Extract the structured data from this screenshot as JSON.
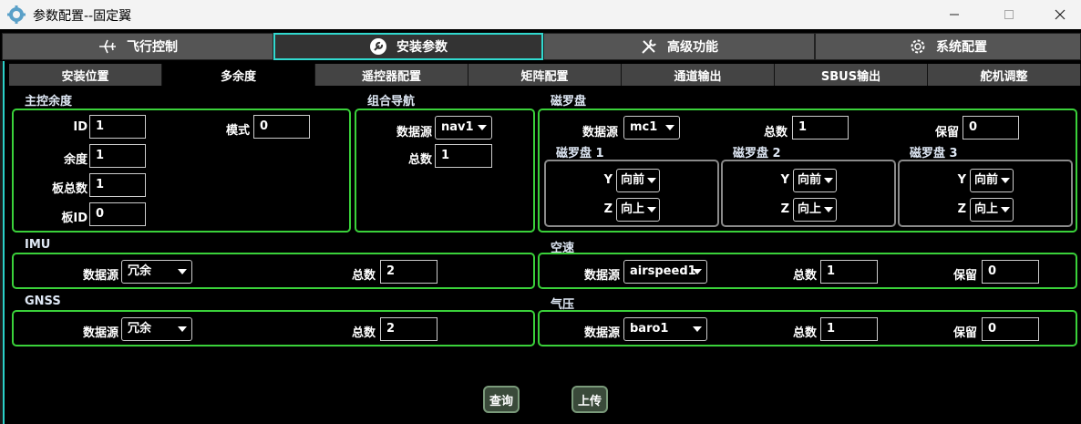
{
  "window": {
    "title": "参数配置--固定翼"
  },
  "top_tabs": [
    {
      "label": "飞行控制",
      "icon": "airplane-icon"
    },
    {
      "label": "安装参数",
      "icon": "wrench-icon"
    },
    {
      "label": "高级功能",
      "icon": "tools-icon"
    },
    {
      "label": "系统配置",
      "icon": "gear-icon"
    }
  ],
  "sub_tabs": [
    "安装位置",
    "多余度",
    "遥控器配置",
    "矩阵配置",
    "通道输出",
    "SBUS输出",
    "舵机调整"
  ],
  "main_control": {
    "title": "主控余度",
    "id_label": "ID",
    "id_value": "1",
    "mode_label": "模式",
    "mode_value": "0",
    "redundancy_label": "余度",
    "redundancy_value": "1",
    "boards_label": "板总数",
    "boards_value": "1",
    "board_id_label": "板ID",
    "board_id_value": "0"
  },
  "integrated_nav": {
    "title": "组合导航",
    "source_label": "数据源",
    "source_value": "nav1",
    "total_label": "总数",
    "total_value": "1"
  },
  "compass": {
    "title": "磁罗盘",
    "source_label": "数据源",
    "source_value": "mc1",
    "total_label": "总数",
    "total_value": "1",
    "reserved_label": "保留",
    "reserved_value": "0",
    "units": [
      {
        "title": "磁罗盘 1",
        "y_label": "Y",
        "y_value": "向前",
        "z_label": "Z",
        "z_value": "向上"
      },
      {
        "title": "磁罗盘 2",
        "y_label": "Y",
        "y_value": "向前",
        "z_label": "Z",
        "z_value": "向上"
      },
      {
        "title": "磁罗盘 3",
        "y_label": "Y",
        "y_value": "向前",
        "z_label": "Z",
        "z_value": "向上"
      }
    ]
  },
  "imu": {
    "title": "IMU",
    "source_label": "数据源",
    "source_value": "冗余",
    "total_label": "总数",
    "total_value": "2"
  },
  "airspeed": {
    "title": "空速",
    "source_label": "数据源",
    "source_value": "airspeed1",
    "total_label": "总数",
    "total_value": "1",
    "reserved_label": "保留",
    "reserved_value": "0"
  },
  "gnss": {
    "title": "GNSS",
    "source_label": "数据源",
    "source_value": "冗余",
    "total_label": "总数",
    "total_value": "2"
  },
  "baro": {
    "title": "气压",
    "source_label": "数据源",
    "source_value": "baro1",
    "total_label": "总数",
    "total_value": "1",
    "reserved_label": "保留",
    "reserved_value": "0"
  },
  "actions": {
    "query_label": "查询",
    "upload_label": "上传"
  },
  "colors": {
    "group_border": "#3ad13a",
    "active_tab_border": "#31d9cf",
    "section_label": "#dfe8f5"
  }
}
